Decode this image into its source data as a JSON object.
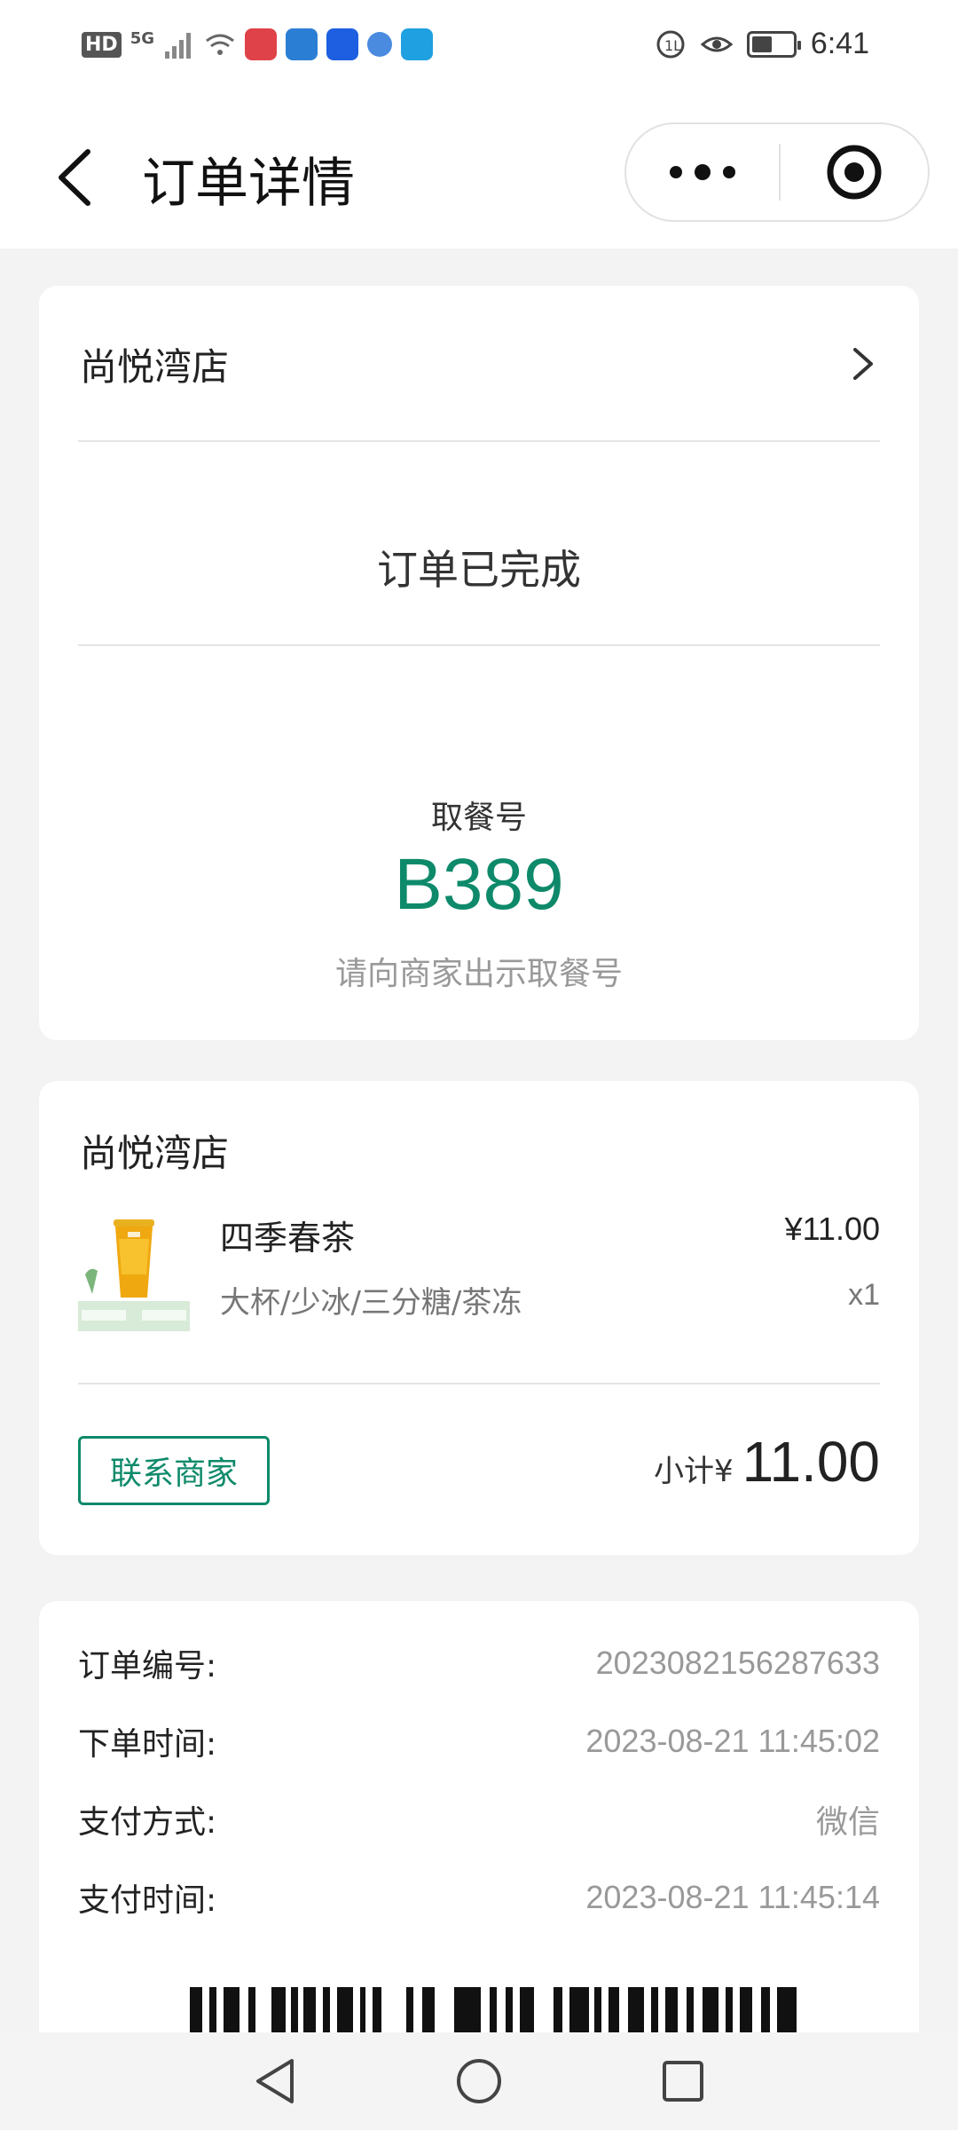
{
  "status_bar": {
    "hd_label": "HD",
    "network_label": "5G",
    "time": "6:41"
  },
  "nav": {
    "title": "订单详情"
  },
  "order_card": {
    "store_name": "尚悦湾店",
    "status": "订单已完成",
    "pickup_label": "取餐号",
    "pickup_number": "B389",
    "pickup_hint": "请向商家出示取餐号"
  },
  "items_card": {
    "store_name": "尚悦湾店",
    "items": [
      {
        "name": "四季春茶",
        "price": "¥11.00",
        "spec": "大杯/少冰/三分糖/茶冻",
        "qty": "x1"
      }
    ],
    "contact_label": "联系商家",
    "subtotal_label": "小计¥",
    "subtotal_value": "11.00"
  },
  "info_card": {
    "rows": [
      {
        "label": "订单编号:",
        "value": "2023082156287633"
      },
      {
        "label": "下单时间:",
        "value": "2023-08-21 11:45:02"
      },
      {
        "label": "支付方式:",
        "value": "微信"
      },
      {
        "label": "支付时间:",
        "value": "2023-08-21 11:45:14"
      }
    ]
  },
  "colors": {
    "accent": "#0e8a6a",
    "background": "#f3f3f3",
    "card": "#ffffff"
  },
  "icons": [
    "back-arrow-icon",
    "more-dots-icon",
    "close-circle-icon",
    "chevron-right-icon",
    "barcode-icon",
    "nav-back-icon",
    "nav-home-icon",
    "nav-recents-icon"
  ]
}
